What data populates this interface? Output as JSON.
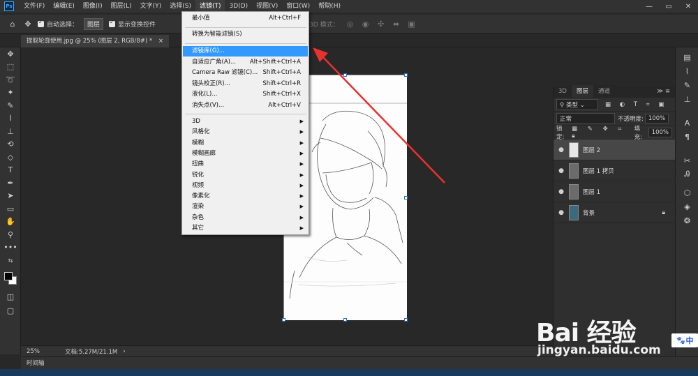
{
  "menubar": {
    "app_logo": "Ps",
    "items": [
      "文件(F)",
      "编辑(E)",
      "图像(I)",
      "图层(L)",
      "文字(Y)",
      "选择(S)",
      "滤镜(T)",
      "3D(D)",
      "视图(V)",
      "窗口(W)",
      "帮助(H)"
    ],
    "active_index": 6,
    "win_minimize": "—",
    "win_restore": "▭",
    "win_close": "✕"
  },
  "options": {
    "auto_select_label": "自动选择：",
    "auto_select_value": "图层",
    "show_transform_label": "显示变换控件",
    "mode_3d_label": "3D 模式："
  },
  "document": {
    "tab_title": "提取轮廓使用.jpg @ 25% (图层 2, RGB/8#) *",
    "tab_close": "×",
    "zoom": "25%",
    "doc_info": "文档:5.27M/21.1M"
  },
  "timeline_label": "时间轴",
  "filter_menu": {
    "items": [
      {
        "label": "最小值",
        "shortcut": "Alt+Ctrl+F"
      },
      {
        "label": "转换为智能滤镜(S)",
        "shortcut": ""
      },
      {
        "label": "滤镜库(G)...",
        "shortcut": ""
      },
      {
        "label": "自适应广角(A)...",
        "shortcut": "Alt+Shift+Ctrl+A"
      },
      {
        "label": "Camera Raw 滤镜(C)...",
        "shortcut": "Shift+Ctrl+A"
      },
      {
        "label": "镜头校正(R)...",
        "shortcut": "Shift+Ctrl+R"
      },
      {
        "label": "液化(L)...",
        "shortcut": "Shift+Ctrl+X"
      },
      {
        "label": "消失点(V)...",
        "shortcut": "Alt+Ctrl+V"
      },
      {
        "label": "3D",
        "shortcut": ""
      },
      {
        "label": "风格化",
        "shortcut": ""
      },
      {
        "label": "模糊",
        "shortcut": ""
      },
      {
        "label": "模糊画廊",
        "shortcut": ""
      },
      {
        "label": "扭曲",
        "shortcut": ""
      },
      {
        "label": "锐化",
        "shortcut": ""
      },
      {
        "label": "视频",
        "shortcut": ""
      },
      {
        "label": "像素化",
        "shortcut": ""
      },
      {
        "label": "渲染",
        "shortcut": ""
      },
      {
        "label": "杂色",
        "shortcut": ""
      },
      {
        "label": "其它",
        "shortcut": ""
      }
    ],
    "submenu_arrow": "▶"
  },
  "layers_panel": {
    "tabs": [
      "3D",
      "图层",
      "通道"
    ],
    "active_tab": 1,
    "filter_kind": "类型",
    "blend_mode": "正常",
    "opacity_label": "不透明度:",
    "opacity_value": "100%",
    "lock_label": "锁定:",
    "fill_label": "填充:",
    "fill_value": "100%",
    "layers": [
      {
        "name": "图层 2",
        "selected": true,
        "locked": false
      },
      {
        "name": "图层 1 拷贝",
        "selected": false,
        "locked": false
      },
      {
        "name": "图层 1",
        "selected": false,
        "locked": false
      },
      {
        "name": "背景",
        "selected": false,
        "locked": true
      }
    ]
  },
  "watermark": {
    "brand": "Bai 经验",
    "url": "jingyan.baidu.com",
    "badge": "中"
  },
  "colors": {
    "menu_highlight": "#3399ff",
    "annotation_arrow": "#e8322e",
    "selection_handle": "#2a6fd6"
  }
}
